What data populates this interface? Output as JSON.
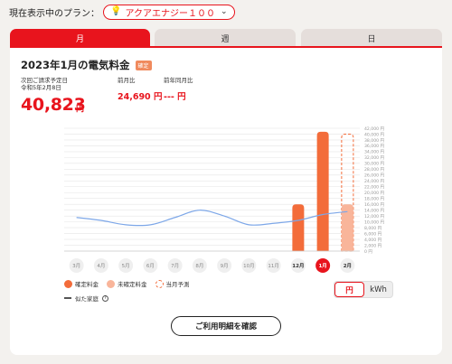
{
  "plan": {
    "label": "現在表示中のプラン：",
    "selected": "アクアエナジー１００",
    "bulb_icon": "💡",
    "chevron_icon": "⌄"
  },
  "tabs": [
    {
      "label": "月",
      "active": true
    },
    {
      "label": "週",
      "active": false
    },
    {
      "label": "日",
      "active": false
    }
  ],
  "summary": {
    "title": "2023年1月の電気料金",
    "badge": "確定",
    "billing_label": "次回ご請求予定日",
    "billing_date": "令和5年2月8日",
    "amount": "40,823",
    "amount_unit": "円",
    "prev_month_label": "前月比",
    "prev_month_value": "24,690 円",
    "prev_year_label": "前年同月比",
    "prev_year_value": "--- 円"
  },
  "chart_data": {
    "type": "bar",
    "categories": [
      "3月",
      "4月",
      "5月",
      "6月",
      "7月",
      "8月",
      "9月",
      "10月",
      "11月",
      "12月",
      "1月",
      "2月"
    ],
    "selected_category": "1月",
    "bold_categories": [
      "12月",
      "1月",
      "2月"
    ],
    "series": [
      {
        "name": "確定料金",
        "values": [
          null,
          null,
          null,
          null,
          null,
          null,
          null,
          null,
          null,
          16000,
          40800,
          null
        ],
        "color": "#f36c3a"
      },
      {
        "name": "未確定料金",
        "values": [
          null,
          null,
          null,
          null,
          null,
          null,
          null,
          null,
          null,
          null,
          null,
          16000
        ],
        "color": "#f9b59a"
      },
      {
        "name": "当月予測",
        "values": [
          null,
          null,
          null,
          null,
          null,
          null,
          null,
          null,
          null,
          null,
          null,
          40000
        ],
        "color": "#f36c3a",
        "style": "dashed-outline"
      },
      {
        "name": "似た家庭",
        "values": [
          11500,
          10500,
          9000,
          9000,
          11500,
          14000,
          12000,
          9000,
          9500,
          10500,
          12500,
          13500
        ],
        "color": "#7da7e8",
        "style": "line"
      }
    ],
    "yticks": [
      "0 円",
      "2,000 円",
      "4,000 円",
      "6,000 円",
      "8,000 円",
      "10,000 円",
      "12,000 円",
      "14,000 円",
      "16,000 円",
      "18,000 円",
      "20,000 円",
      "22,000 円",
      "24,000 円",
      "26,000 円",
      "28,000 円",
      "30,000 円",
      "32,000 円",
      "34,000 円",
      "36,000 円",
      "38,000 円",
      "40,000 円",
      "42,000 円"
    ],
    "ylim": [
      0,
      42000
    ],
    "grid": true
  },
  "legend": {
    "confirmed": "確定料金",
    "unconfirmed": "未確定料金",
    "forecast": "当月予測",
    "similar": "似た家庭",
    "help_icon": "?"
  },
  "unit_toggle": {
    "yen": "円",
    "kwh": "kWh",
    "selected": "円"
  },
  "detail_button": "ご利用明細を確認"
}
